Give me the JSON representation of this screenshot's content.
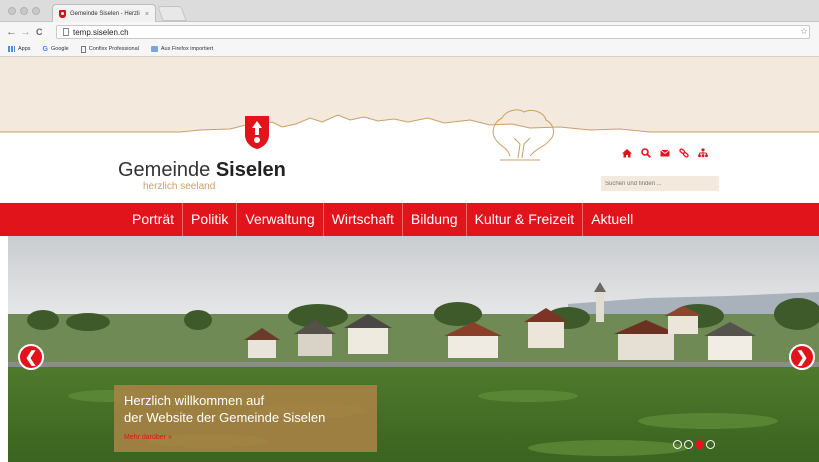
{
  "browser": {
    "tab_title": "Gemeinde Siselen - Herzli",
    "tab_close": "×",
    "url": "temp.siselen.ch",
    "back": "←",
    "forward": "→",
    "reload": "C",
    "star": "☆",
    "bookmarks": [
      {
        "label": "Apps",
        "icon": "apps-icon"
      },
      {
        "label": "Google",
        "icon": "google-icon"
      },
      {
        "label": "Confixx Professional",
        "icon": "document-icon"
      },
      {
        "label": "Aus Firefox importiert",
        "icon": "folder-icon"
      }
    ]
  },
  "site": {
    "title_regular": "Gemeinde ",
    "title_bold": "Siselen",
    "tagline": "herzlich seeland",
    "search_placeholder": "Suchen und finden ...",
    "header_icons": [
      "home-icon",
      "search-icon",
      "mail-icon",
      "link-icon",
      "sitemap-icon"
    ],
    "nav": [
      "Porträt",
      "Politik",
      "Verwaltung",
      "Wirtschaft",
      "Bildung",
      "Kultur & Freizeit",
      "Aktuell"
    ]
  },
  "slider": {
    "headline_line1": "Herzlich willkommen auf",
    "headline_line2": "der Website der Gemeinde Siselen",
    "more_link": "Mehr darüber »",
    "prev": "❮",
    "next": "❯",
    "slide_count": 4,
    "active_slide": 3
  },
  "colors": {
    "brand_red": "#e1141c",
    "beige": "#f3e9dc",
    "gold": "#c9a06a"
  }
}
